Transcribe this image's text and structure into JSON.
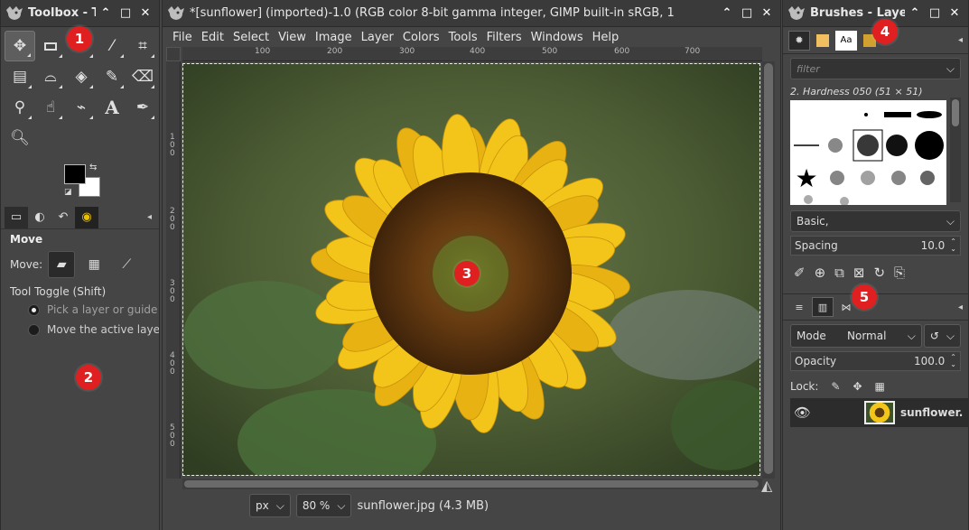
{
  "toolbox": {
    "title": "Toolbox - T",
    "tool_options_title": "Move",
    "move_label": "Move:",
    "tool_toggle_label": "Tool Toggle  (Shift)",
    "radio_pick": "Pick a layer or guide",
    "radio_move": "Move the active laye",
    "tools": [
      "move-tool",
      "rect-select-tool",
      "lasso-tool",
      "fuzzy-select-tool",
      "crop-tool",
      "transform-tool",
      "warp-tool",
      "bucket-fill-tool",
      "paintbrush-tool",
      "eraser-tool",
      "clone-tool",
      "smudge-tool",
      "paths-tool",
      "text-tool",
      "color-picker-tool",
      "zoom-tool"
    ]
  },
  "image_window": {
    "title": "*[sunflower] (imported)-1.0 (RGB color 8-bit gamma integer, GIMP built-in sRGB, 1",
    "menu": [
      "File",
      "Edit",
      "Select",
      "View",
      "Image",
      "Layer",
      "Colors",
      "Tools",
      "Filters",
      "Windows",
      "Help"
    ],
    "ruler_h": [
      "100",
      "200",
      "300",
      "400",
      "500",
      "600",
      "700"
    ],
    "ruler_v": [
      "1\n0\n0",
      "2\n0\n0",
      "3\n0\n0",
      "4\n0\n0",
      "5\n0\n0"
    ],
    "unit": "px",
    "zoom": "80 %",
    "file_info": "sunflower.jpg (4.3  MB)"
  },
  "dock": {
    "title": "Brushes - Laye",
    "filter_placeholder": "filter",
    "brush_name": "2. Hardness 050 (51 × 51)",
    "preset": "Basic,",
    "spacing_label": "Spacing",
    "spacing_value": "10.0",
    "mode_label": "Mode",
    "mode_value": "Normal",
    "opacity_label": "Opacity",
    "opacity_value": "100.0",
    "lock_label": "Lock:",
    "layer_name": "sunflower."
  },
  "badges": [
    "1",
    "2",
    "3",
    "4",
    "5"
  ],
  "colors": {
    "badge": "#e02020",
    "panel": "#454545",
    "petal": "#f3c51a"
  }
}
